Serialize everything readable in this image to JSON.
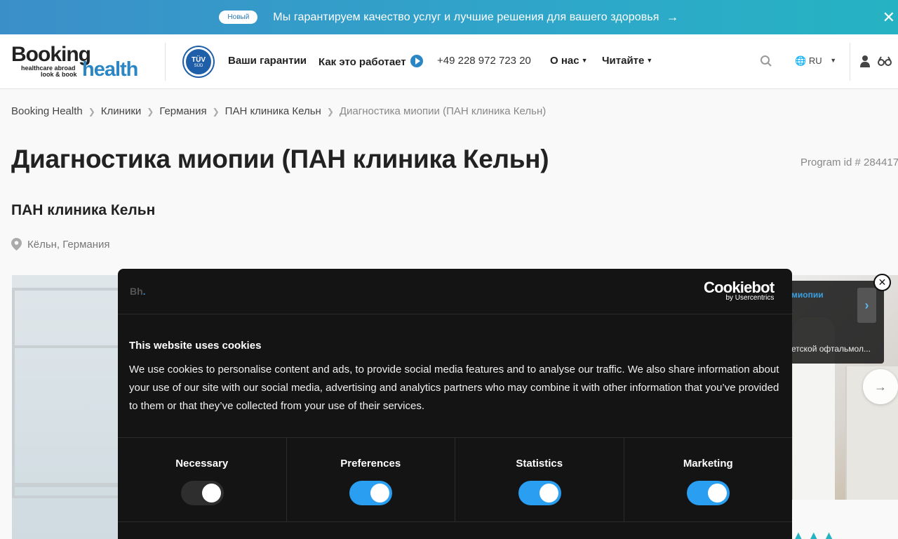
{
  "banner": {
    "badge": "Новый",
    "text": "Мы гарантируем качество услуг и лучшие решения для вашего здоровья"
  },
  "header": {
    "logo_booking": "Booking",
    "logo_sub1": "healthcare abroad",
    "logo_sub2": "look & book",
    "logo_health": "health",
    "tuv_text": "TÜV",
    "tuv_sub": "SÜD",
    "nav": {
      "guarantees": "Ваши гарантии",
      "how_it_works": "Как это работает",
      "phone": "+49 228 972 723 20",
      "about": "О нас",
      "read": "Читайте"
    },
    "lang": "RU"
  },
  "breadcrumb": {
    "items": [
      "Booking Health",
      "Клиники",
      "Германия",
      "ПАН клиника Кельн"
    ],
    "current": "Диагностика миопии (ПАН клиника Кельн)"
  },
  "page": {
    "title": "Диагностика миопии (ПАН клиника Кельн)",
    "program_id": "Program id # 284417",
    "clinic": "ПАН клиника Кельн",
    "location": "Кёльн, Германия"
  },
  "related": {
    "tag": "миопии",
    "title": "етской офтальмол..."
  },
  "cookie": {
    "logo_b": "Bh",
    "logo_dot": ".",
    "brand": "Cookiebot",
    "brand_by": "by Usercentrics",
    "title": "This website uses cookies",
    "text": "We use cookies to personalise content and ads, to provide social media features and to analyse our traffic. We also share information about your use of our site with our social media, advertising and analytics partners who may combine it with other information that you’ve provided to them or that they’ve collected from your use of their services.",
    "options": [
      {
        "label": "Necessary",
        "enabled": true,
        "locked": true
      },
      {
        "label": "Preferences",
        "enabled": true,
        "locked": false
      },
      {
        "label": "Statistics",
        "enabled": true,
        "locked": false
      },
      {
        "label": "Marketing",
        "enabled": true,
        "locked": false
      }
    ]
  },
  "colors": {
    "accent": "#2a86c4",
    "toggle_on": "#2a9ef0",
    "dialog_bg": "#141414"
  }
}
